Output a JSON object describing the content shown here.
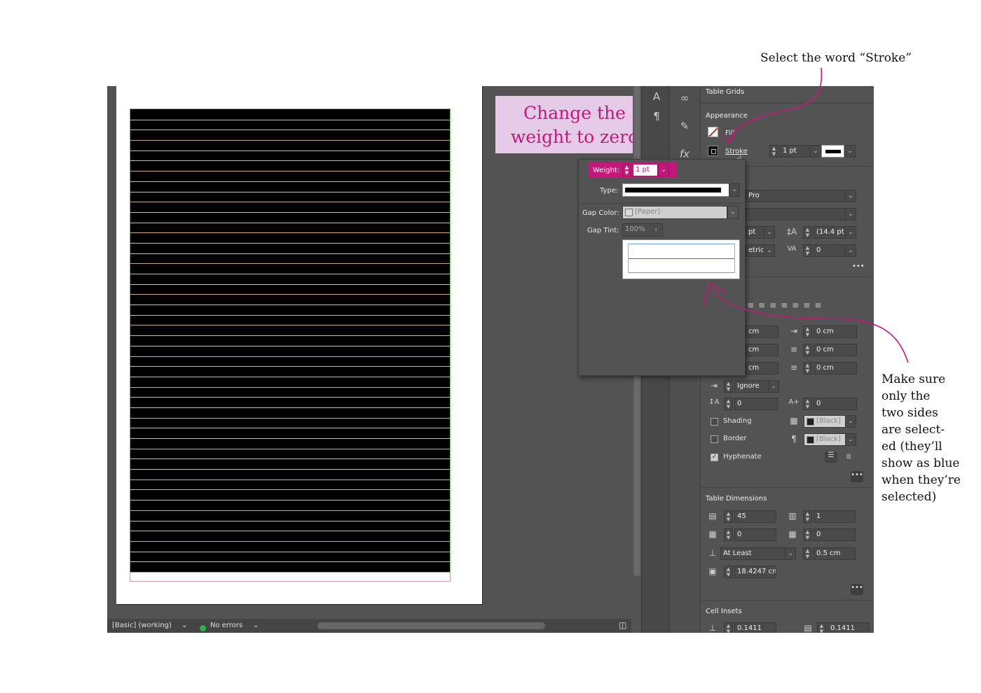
{
  "annotations": {
    "top": "Select the word “Stroke”",
    "side_lines": [
      "Make sure",
      "only the",
      "two sides",
      "are select-",
      "ed (they’ll",
      "show as blue",
      "when they’re",
      "selected)"
    ],
    "callout_lines": [
      "Change the",
      "weight to zero"
    ],
    "accent_color": "#c4187a"
  },
  "table_rows": 45,
  "statusbar": {
    "profile": "[Basic] (working)",
    "errors": "No errors"
  },
  "side_strip_icons": [
    "character-icon",
    "paragraph-icon",
    "links-icon",
    "content-icon",
    "effects-icon"
  ],
  "panel": {
    "table_grids": "Table Grids",
    "appearance": "Appearance",
    "fill_label": "Fill",
    "stroke_label": "Stroke",
    "stroke_weight": "1 pt",
    "font_name": "Pro",
    "font_size": "pt",
    "leading": "(14.4 pt",
    "kerning": "etrics",
    "tracking": "0",
    "indent_left": "cm",
    "indent_right_first": "cm",
    "indent_last": "cm",
    "indent_right": "0 cm",
    "space_before": "0 cm",
    "space_after": "0 cm",
    "align_to_grid": "Ignore",
    "drop_cap_lines": "0",
    "drop_cap_chars": "0",
    "shading_label": "Shading",
    "shading_color": "[Black]",
    "border_label": "Border",
    "border_color": "[Black]",
    "hyphenate_label": "Hyphenate",
    "table_dimensions": "Table Dimensions",
    "body_rows": "45",
    "columns": "1",
    "header_rows": "0",
    "footer_rows": "0",
    "row_height_mode": "At Least",
    "row_height": "0.5 cm",
    "column_width": "18.4247 cn",
    "cell_insets": "Cell Insets",
    "inset_top": "0.1411",
    "inset_right": "0.1411"
  },
  "popup": {
    "weight_label": "Weight:",
    "weight_value": "1 pt",
    "type_label": "Type:",
    "gap_color_label": "Gap Color:",
    "gap_color_value": "[Paper]",
    "gap_tint_label": "Gap Tint:",
    "gap_tint_value": "100%"
  }
}
